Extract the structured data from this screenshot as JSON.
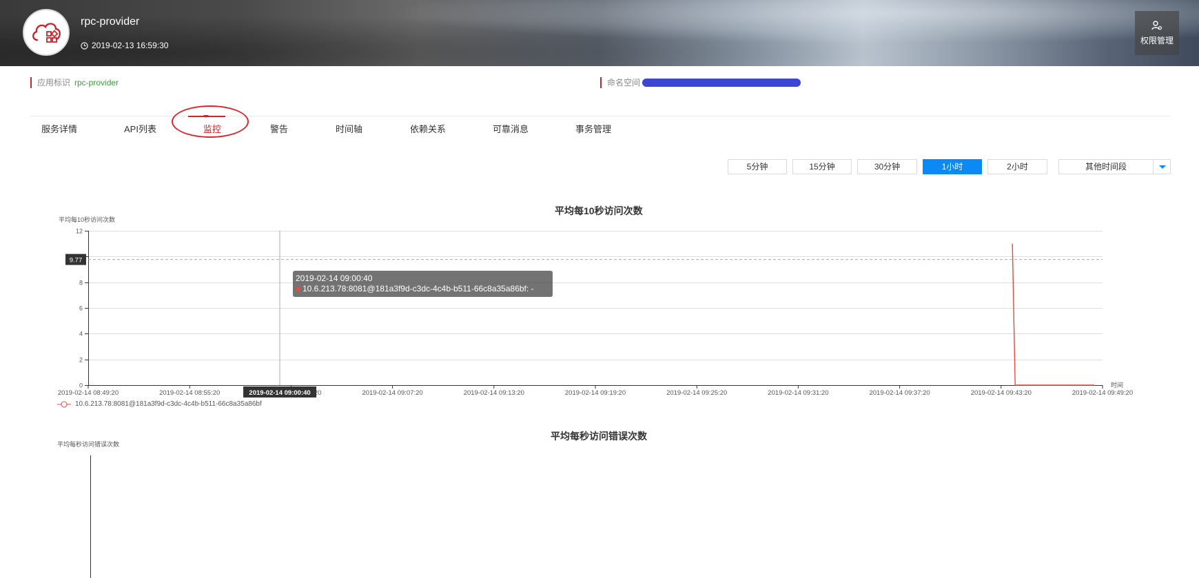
{
  "app": {
    "name": "rpc-provider",
    "timestamp": "2019-02-13 16:59:30",
    "permission_button": "权限管理"
  },
  "info": {
    "app_id_label": "应用标识",
    "app_id_value": "rpc-provider",
    "namespace_label": "命名空间"
  },
  "tabs": [
    {
      "label": "服务详情",
      "active": false
    },
    {
      "label": "API列表",
      "active": false
    },
    {
      "label": "监控",
      "active": true
    },
    {
      "label": "警告",
      "active": false
    },
    {
      "label": "时间轴",
      "active": false
    },
    {
      "label": "依赖关系",
      "active": false
    },
    {
      "label": "可靠消息",
      "active": false
    },
    {
      "label": "事务管理",
      "active": false
    }
  ],
  "time_ranges": [
    {
      "label": "5分钟",
      "active": false
    },
    {
      "label": "15分钟",
      "active": false
    },
    {
      "label": "30分钟",
      "active": false
    },
    {
      "label": "1小时",
      "active": true
    },
    {
      "label": "2小时",
      "active": false
    }
  ],
  "other_range": "其他时间段",
  "colors": {
    "accent": "#0b8af5",
    "brand_red": "#c8262c",
    "series": "#e8483d"
  },
  "chart_data": [
    {
      "type": "line",
      "title": "平均每10秒访问次数",
      "ylabel": "平均每10秒访问次数",
      "xlabel": "时间",
      "ylim": [
        0,
        12
      ],
      "yticks": [
        0,
        2,
        4,
        6,
        8,
        10,
        12
      ],
      "x_tick_labels": [
        "2019-02-14 08:49:20",
        "2019-02-14 08:55:20",
        "2019-02-14 09:01:20",
        "2019-02-14 09:07:20",
        "2019-02-14 09:13:20",
        "2019-02-14 09:19:20",
        "2019-02-14 09:25:20",
        "2019-02-14 09:31:20",
        "2019-02-14 09:37:20",
        "2019-02-14 09:43:20",
        "2019-02-14 09:49:20"
      ],
      "x_range": [
        "2019-02-14 08:49:20",
        "2019-02-14 09:49:20"
      ],
      "crosshair_x": "2019-02-14 09:00:40",
      "crosshair_x_label": "2019-02-14 09:00:40",
      "crosshair_y": 9.77,
      "crosshair_y_label": "9.77",
      "series": [
        {
          "name": "10.6.213.78:8081@181a3f9d-c3dc-4c4b-b511-66c8a35a86bf",
          "points": [
            [
              "2019-02-14 09:44:00",
              11
            ],
            [
              "2019-02-14 09:44:10",
              0
            ],
            [
              "2019-02-14 09:48:50",
              0
            ]
          ]
        }
      ],
      "tooltip": {
        "time": "2019-02-14 09:00:40",
        "entry": "10.6.213.78:8081@181a3f9d-c3dc-4c4b-b511-66c8a35a86bf: -"
      },
      "legend": "10.6.213.78:8081@181a3f9d-c3dc-4c4b-b511-66c8a35a86bf",
      "grid": true
    },
    {
      "type": "line",
      "title": "平均每秒访问错误次数",
      "ylabel": "平均每秒访问错误次数",
      "series": []
    }
  ]
}
